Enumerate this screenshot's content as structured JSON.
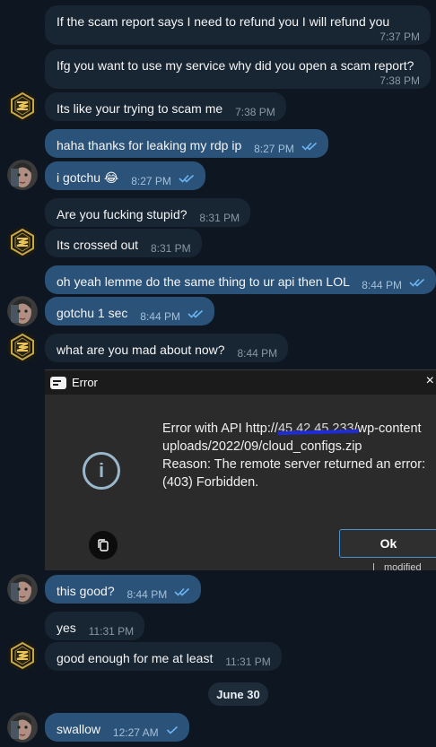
{
  "messages": [
    {
      "text": "If the scam report says I need to refund you I will refund you",
      "time": "7:37 PM"
    },
    {
      "text": "Ifg you want to use my service why did you open a scam report?",
      "time": "7:38 PM"
    },
    {
      "text": "Its like your trying to scam me",
      "time": "7:38 PM"
    },
    {
      "text": "haha thanks for leaking my rdp ip",
      "time": "8:27 PM"
    },
    {
      "text": "i gotchu 😂",
      "time": "8:27 PM"
    },
    {
      "text": "Are you fucking stupid?",
      "time": "8:31 PM"
    },
    {
      "text": "Its crossed out",
      "time": "8:31 PM"
    },
    {
      "text": "oh yeah lemme do the same thing to ur api then LOL",
      "time": "8:44 PM"
    },
    {
      "text": "gotchu 1 sec",
      "time": "8:44 PM"
    },
    {
      "text": "what are you mad about now?",
      "time": "8:44 PM"
    },
    {
      "text": "this good?",
      "time": "8:44 PM"
    },
    {
      "text": "yes",
      "time": "11:31 PM"
    },
    {
      "text": "good enough for me at least",
      "time": "11:31 PM"
    },
    {
      "text": "swallow",
      "time": "12:27 AM"
    }
  ],
  "date_separator": "June 30",
  "error_dialog": {
    "title": "Error",
    "line1_prefix": "Error with API http://",
    "line1_struck": "45.42.45.233",
    "line1_suffix": "/wp-content",
    "line2": "uploads/2022/09/cloud_configs.zip",
    "line3": "Reason: The remote server returned an error:",
    "line4": "(403) Forbidden.",
    "ok_label": "Ok",
    "footer_text": "modified",
    "close_glyph": "×",
    "info_glyph": "i"
  },
  "colors": {
    "background": "#0e1621",
    "incoming_bubble": "#182533",
    "outgoing_bubble": "#2b5278",
    "read_check": "#6ab3f3",
    "dialog_bg": "#2b2b2b"
  },
  "icons": [
    "double-check-icon",
    "single-check-icon",
    "gold-emblem-avatar",
    "face-avatar",
    "info-icon",
    "copy-icon"
  ]
}
